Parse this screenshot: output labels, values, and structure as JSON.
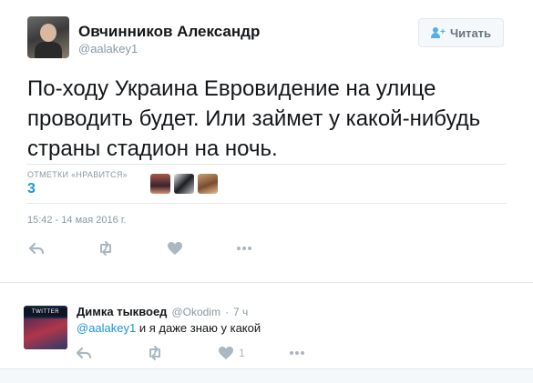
{
  "tweet": {
    "author_name": "Овчинников Александр",
    "author_handle": "@aalakey1",
    "follow_label": "Читать",
    "text": "По-ходу Украина Евровидение на улице проводить будет. Или займет у какой-нибудь страны стадион на ночь.",
    "likes_label": "ОТМЕТКИ «НРАВИТСЯ»",
    "likes_count": "3",
    "timestamp": "15:42 - 14 мая 2016 г.",
    "actions": [
      {
        "icon": "reply-icon"
      },
      {
        "icon": "retweet-icon"
      },
      {
        "icon": "like-icon"
      },
      {
        "icon": "more-icon"
      }
    ]
  },
  "reply": {
    "author_name": "Димка тыквоед",
    "author_handle": "@Okodim",
    "separator": "·",
    "time": "7 ч",
    "avatar_banner": "TWITTER",
    "mention": "@aalakey1",
    "text": "и я даже знаю у какой",
    "like_count": "1"
  },
  "colors": {
    "accent": "#1b95e0",
    "muted": "#8899a6",
    "icon": "#aab8c2",
    "border": "#e1e8ed"
  }
}
